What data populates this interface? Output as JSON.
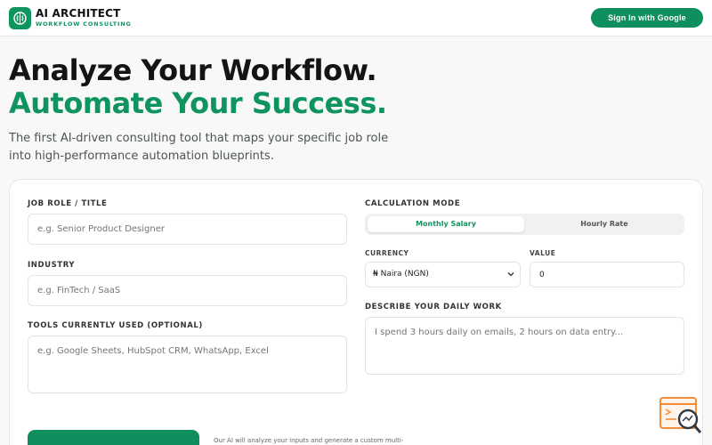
{
  "header": {
    "brand_title": "AI ARCHITECT",
    "brand_subtitle": "WORKFLOW CONSULTING",
    "signin_label": "Sign In with Google"
  },
  "hero": {
    "title_line1": "Analyze Your Workflow.",
    "title_line2": "Automate Your Success.",
    "description": "The first AI-driven consulting tool that maps your specific job role into high-performance automation blueprints."
  },
  "form": {
    "job_role": {
      "label": "JOB ROLE / TITLE",
      "placeholder": "e.g. Senior Product Designer"
    },
    "industry": {
      "label": "INDUSTRY",
      "placeholder": "e.g. FinTech / SaaS"
    },
    "tools": {
      "label": "TOOLS CURRENTLY USED (OPTIONAL)",
      "placeholder": "e.g. Google Sheets, HubSpot CRM, WhatsApp, Excel"
    },
    "calc_mode": {
      "label": "CALCULATION MODE",
      "options": [
        "Monthly Salary",
        "Hourly Rate"
      ],
      "selected": "Monthly Salary"
    },
    "currency": {
      "label": "CURRENCY",
      "value": "₦ Naira (NGN)"
    },
    "value": {
      "label": "VALUE",
      "value": "0"
    },
    "daily_work": {
      "label": "DESCRIBE YOUR DAILY WORK",
      "placeholder": "I spend 3 hours daily on emails, 2 hours on data entry..."
    },
    "footnote": "Our AI will analyze your inputs and generate a custom multi-"
  },
  "colors": {
    "accent": "#0f9460",
    "widget": "#f28c3a"
  }
}
